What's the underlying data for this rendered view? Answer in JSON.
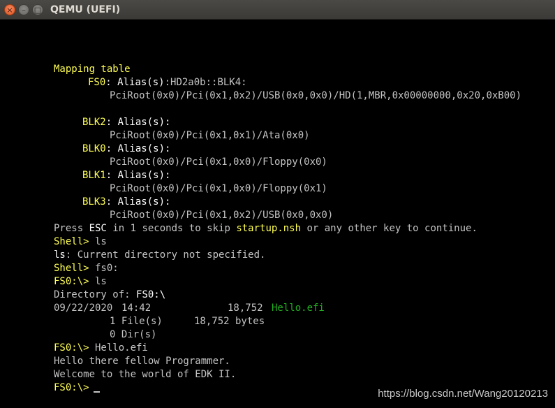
{
  "window": {
    "title": "QEMU (UEFI)"
  },
  "colors": {
    "background": "#000000",
    "text": "#c4c4c4",
    "highlight": "#ffff55",
    "bright": "#ffffff",
    "file": "#21b021"
  },
  "mapping": {
    "heading": "Mapping table",
    "fs0": {
      "name": "FS0",
      "label": ": Alias(s)",
      "aliases": ":HD2a0b::BLK4:",
      "path": "PciRoot(0x0)/Pci(0x1,0x2)/USB(0x0,0x0)/HD(1,MBR,0x00000000,0x20,0xB00)"
    },
    "blk2": {
      "name": "BLK2",
      "label": ": Alias(s):",
      "path": "PciRoot(0x0)/Pci(0x1,0x1)/Ata(0x0)"
    },
    "blk0": {
      "name": "BLK0",
      "label": ": Alias(s):",
      "path": "PciRoot(0x0)/Pci(0x1,0x0)/Floppy(0x0)"
    },
    "blk1": {
      "name": "BLK1",
      "label": ": Alias(s):",
      "path": "PciRoot(0x0)/Pci(0x1,0x0)/Floppy(0x1)"
    },
    "blk3": {
      "name": "BLK3",
      "label": ": Alias(s):",
      "path": "PciRoot(0x0)/Pci(0x1,0x2)/USB(0x0,0x0)"
    }
  },
  "startup": {
    "pre": "Press ",
    "esc": "ESC",
    "mid": " in 1 seconds to skip ",
    "script": "startup.nsh",
    "post": " or any other key to continue."
  },
  "session": {
    "prompt_shell": "Shell>",
    "cmd_ls": " ls",
    "ls_name": "ls",
    "ls_error": ": Current directory not specified.",
    "cmd_fs0": " fs0:",
    "prompt_fs0": "FS0:\\>",
    "cmd_ls2": " ls",
    "dir_label": "Directory of: ",
    "dir_path": "FS0:\\",
    "file_date": "09/22/2020",
    "file_time": "14:42",
    "file_size": "18,752",
    "file_name": "Hello.efi",
    "files_count": "1 File(s)",
    "files_bytes": "18,752 bytes",
    "dirs_count": "0 Dir(s)",
    "cmd_hello": " Hello.efi",
    "out1": "Hello there fellow Programmer.",
    "out2": "Welcome to the world of EDK II."
  },
  "watermark": "https://blog.csdn.net/Wang20120213"
}
